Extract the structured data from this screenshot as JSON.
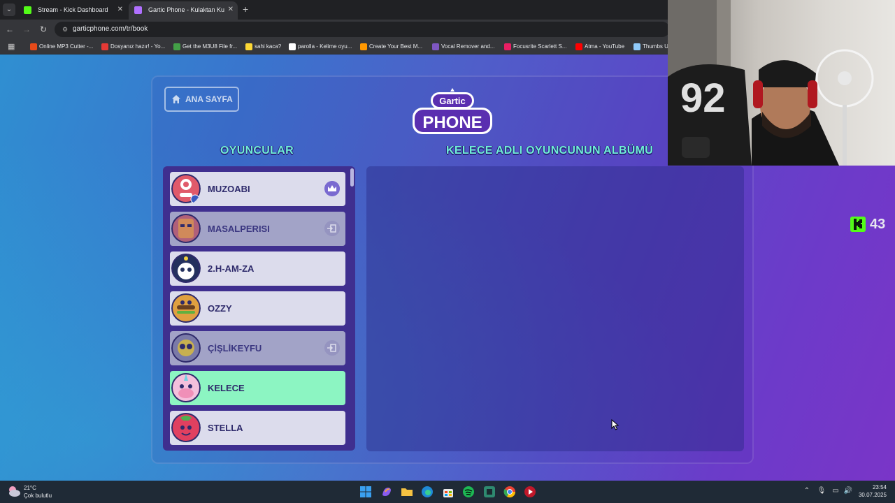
{
  "browser": {
    "tabs": [
      {
        "title": "Stream - Kick Dashboard",
        "favicon_color": "#53fc18"
      },
      {
        "title": "Gartic Phone - Kulaktan Ku",
        "favicon_color": "#b070ff"
      }
    ],
    "url": "garticphone.com/tr/book",
    "bookmarks": [
      {
        "label": "Online MP3 Cutter -...",
        "color": "#e64a19"
      },
      {
        "label": "Dosyanız hazır! - Yo...",
        "color": "#e53935"
      },
      {
        "label": "Get the M3U8 File fr...",
        "color": "#43a047"
      },
      {
        "label": "sahi kaca?",
        "color": "#fdd835"
      },
      {
        "label": "parolla - Kelime oyu...",
        "color": "#ffffff"
      },
      {
        "label": "Create Your Best M...",
        "color": "#ff9800"
      },
      {
        "label": "Vocal Remover and...",
        "color": "#7e57c2"
      },
      {
        "label": "Focusrite Scarlett S...",
        "color": "#e91e63"
      },
      {
        "label": "Atma - YouTube",
        "color": "#ff0000"
      },
      {
        "label": "Thumbs U",
        "color": "#90caf9"
      }
    ]
  },
  "game": {
    "home_label": "ANA SAYFA",
    "logo_top": "Gartic",
    "logo_bottom": "PHONE",
    "players_title": "OYUNCULAR",
    "album_title": "KELECE ADLI OYUNCUNUN ALBÜMÜ",
    "players": [
      {
        "name": "MUZOABI",
        "state": "normal",
        "badge": "crown-icon",
        "avatar_color": "#e05a6a"
      },
      {
        "name": "MASALPERISI",
        "state": "dim",
        "badge": "exit-icon",
        "avatar_color": "#c0506a"
      },
      {
        "name": "2.H-AM-ZA",
        "state": "normal",
        "badge": "",
        "avatar_color": "#3a4a9a"
      },
      {
        "name": "OZZY",
        "state": "normal",
        "badge": "",
        "avatar_color": "#e0a040"
      },
      {
        "name": "ÇİŞLİKEYFU",
        "state": "dim",
        "badge": "exit-icon",
        "avatar_color": "#7a7aa8"
      },
      {
        "name": "KELECE",
        "state": "active",
        "badge": "",
        "avatar_color": "#f0b0d0"
      },
      {
        "name": "STELLA",
        "state": "normal",
        "badge": "",
        "avatar_color": "#e04060"
      }
    ],
    "viewer_count": "43"
  },
  "taskbar": {
    "temperature": "21°C",
    "condition": "Çok bulutlu",
    "time": "23:54",
    "date": "30.07.2025"
  }
}
